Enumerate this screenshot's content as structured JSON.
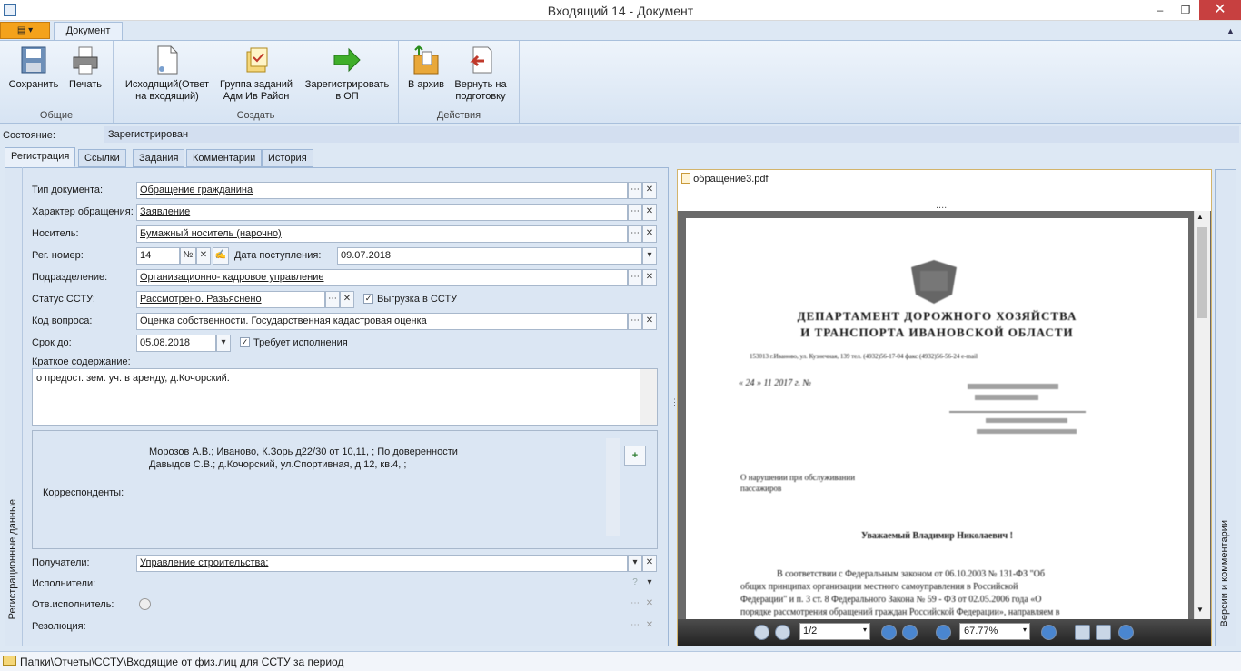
{
  "window": {
    "title": "Входящий 14 - Документ",
    "minimize": "–",
    "maximize": "❐",
    "close": "✕"
  },
  "ribbon": {
    "tab": "Документ",
    "groups": [
      {
        "label": "Общие",
        "buttons": [
          "Сохранить",
          "Печать"
        ]
      },
      {
        "label": "Создать",
        "buttons": [
          "Исходящий(Ответ на входящий)",
          "Группа заданий Адм Ив Район",
          "Зарегистрировать в ОП"
        ]
      },
      {
        "label": "Действия",
        "buttons": [
          "В архив",
          "Вернуть на подготовку"
        ]
      }
    ],
    "btn": {
      "save_1": "Сохранить",
      "print_1": "Печать",
      "out_1": "Исходящий(Ответ",
      "out_2": "на входящий)",
      "grp_1": "Группа заданий",
      "grp_2": "Адм Ив Район",
      "reg_1": "Зарегистрировать",
      "reg_2": "в ОП",
      "arch_1": "В архив",
      "ret_1": "Вернуть на",
      "ret_2": "подготовку"
    }
  },
  "state": {
    "label": "Состояние:",
    "value": "Зарегистрирован"
  },
  "tabs": [
    "Регистрация",
    "Ссылки",
    "Задания",
    "Комментарии",
    "История"
  ],
  "form": {
    "side_tab": "Регистрационные данные",
    "doc_type": {
      "label": "Тип документа:",
      "value": "Обращение гражданина"
    },
    "appeal_kind": {
      "label": "Характер обращения:",
      "value": "Заявление"
    },
    "carrier": {
      "label": "Носитель:",
      "value": "Бумажный носитель (нарочно)"
    },
    "reg_num": {
      "label": "Рег. номер:",
      "value": "14",
      "num_sign": "№"
    },
    "received": {
      "label": "Дата поступления:",
      "value": "09.07.2018"
    },
    "department": {
      "label": "Подразделение:",
      "value": "Организационно- кадровое управление"
    },
    "sstu_status": {
      "label": "Статус ССТУ:",
      "value": "Рассмотрено. Разъяснено",
      "upload_label": "Выгрузка в ССТУ",
      "upload_checked": true
    },
    "question_code": {
      "label": "Код вопроса:",
      "value": "Оценка собственности. Государственная кадастровая оценка"
    },
    "due": {
      "label": "Срок до:",
      "value": "05.08.2018",
      "requires_label": "Требует исполнения",
      "requires_checked": true
    },
    "summary": {
      "label": "Краткое содержание:",
      "value": "о предост. зем. уч. в аренду, д.Кочорский."
    },
    "correspondents": {
      "label": "Корреспонденты:",
      "items": [
        "Морозов А.В.; Иваново, К.Зорь д22/30 от 10,11, ; По доверенности",
        "Давыдов С.В.; д.Кочорский, ул.Спортивная, д.12, кв.4, ;"
      ]
    },
    "recipients": {
      "label": "Получатели:",
      "value": "Управление строительства;"
    },
    "executors": {
      "label": "Исполнители:"
    },
    "resp_executor": {
      "label": "Отв.исполнитель:"
    },
    "resolution": {
      "label": "Резолюция:"
    }
  },
  "pdf": {
    "file": "обращение3.pdf",
    "page": "1/2",
    "zoom": "67.77%",
    "side_tab": "Версии и комментарии",
    "dots": "....",
    "content": {
      "org_1": "ДЕПАРТАМЕНТ ДОРОЖНОГО ХОЗЯЙСТВА",
      "org_2": "И ТРАНСПОРТА ИВАНОВСКОЙ ОБЛАСТИ",
      "address": "153013 г.Иваново, ул. Кузнечная, 139 тел. (4932)56-17-04 факс (4932)56-56-24 e-mail",
      "date_line": "« 24 » 11 2017 г. №",
      "subject_1": "О нарушении при обслуживании",
      "subject_2": "пассажиров",
      "greeting": "Уважаемый Владимир Николаевич !",
      "p1": "В соответствии с Федеральным законом от 06.10.2003 № 131-ФЗ \"Об",
      "p2": "общих принципах организации местного самоуправления в Российской",
      "p3": "Федерации\" и п. 3 ст. 8 Федерального Закона № 59 - ФЗ от 02.05.2006 года «О",
      "p4": "порядке рассмотрения обращений граждан Российской Федерации», направляем в"
    }
  },
  "statusbar": {
    "path": "Папки\\Отчеты\\ССТУ\\Входящие от физ.лиц для ССТУ за период"
  },
  "colors": {
    "accent": "#f4a21b",
    "ribbon": "#d7e4f3",
    "panel": "#dbe6f3",
    "close": "#c74040"
  }
}
